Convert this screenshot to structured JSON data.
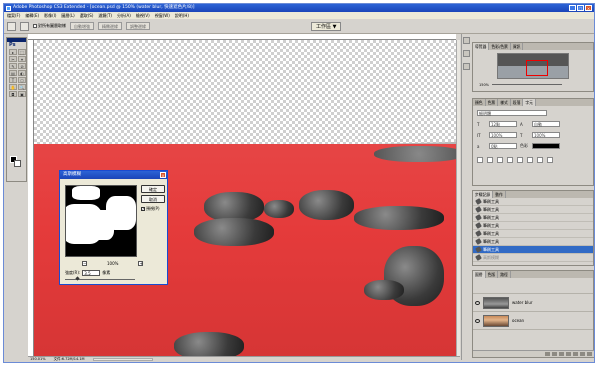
{
  "window": {
    "title": "Adobe Photoshop CS3 Extended - [ocean.psd @ 150% (water blur, 快速遮色片/8)]",
    "controls": [
      "_",
      "□",
      "×"
    ]
  },
  "menu": [
    "檔案(F)",
    "編輯(E)",
    "影像(I)",
    "圖層(L)",
    "選取(S)",
    "濾鏡(T)",
    "分析(A)",
    "檢視(V)",
    "視窗(W)",
    "說明(H)"
  ],
  "options_bar": {
    "checkbox_label": "對所有圖層取樣",
    "buttons": [
      "自動增強",
      "精緻邊緣",
      "調整邊緣"
    ],
    "workspace_label": "工作區 ▼"
  },
  "toolbox": {
    "logo": "Ps",
    "tools": [
      "▸",
      "⬚",
      "✂",
      "⌖",
      "✎",
      "⊘",
      "▤",
      "◐",
      "T",
      "⬡",
      "✋",
      "🔍",
      "◘",
      "▣"
    ]
  },
  "document": {
    "zoom": "150.01%",
    "doc_info": "文件:6.72M/14.1M"
  },
  "dialog": {
    "title": "高斯模糊",
    "ok": "確定",
    "cancel": "取消",
    "preview_label": "預視(P)",
    "preview_checked": true,
    "zoom_out": "−",
    "zoom_in": "+",
    "zoom_percent": "100%",
    "radius_label": "強度(R):",
    "radius_value": "3.5",
    "radius_unit": "像素",
    "radius_fraction": 0.18
  },
  "navigator": {
    "tabs": [
      "導覽器",
      "色彩/色票",
      "資訊"
    ],
    "zoom": "150%"
  },
  "character": {
    "tabs": [
      "顏色",
      "色票",
      "樣式",
      "段落",
      "字元"
    ],
    "font": "細明體",
    "fields": [
      {
        "label": "T",
        "value": "12點"
      },
      {
        "label": "A",
        "value": "自動"
      },
      {
        "label": "IT",
        "value": "100%"
      },
      {
        "label": "T",
        "value": "100%"
      },
      {
        "label": "a",
        "value": "0點"
      },
      {
        "label": "色彩",
        "value": ""
      }
    ]
  },
  "history": {
    "tabs": [
      "步驟記錄",
      "動作"
    ],
    "items": [
      "筆刷工具",
      "筆刷工具",
      "筆刷工具",
      "筆刷工具",
      "筆刷工具",
      "筆刷工具",
      "筆刷工具",
      "高斯模糊"
    ],
    "selected_index": 6
  },
  "layers": {
    "tabs": [
      "圖層",
      "色版",
      "路徑"
    ],
    "items": [
      {
        "name": "water blur",
        "visible": true
      },
      {
        "name": "ocean",
        "visible": true
      }
    ]
  }
}
